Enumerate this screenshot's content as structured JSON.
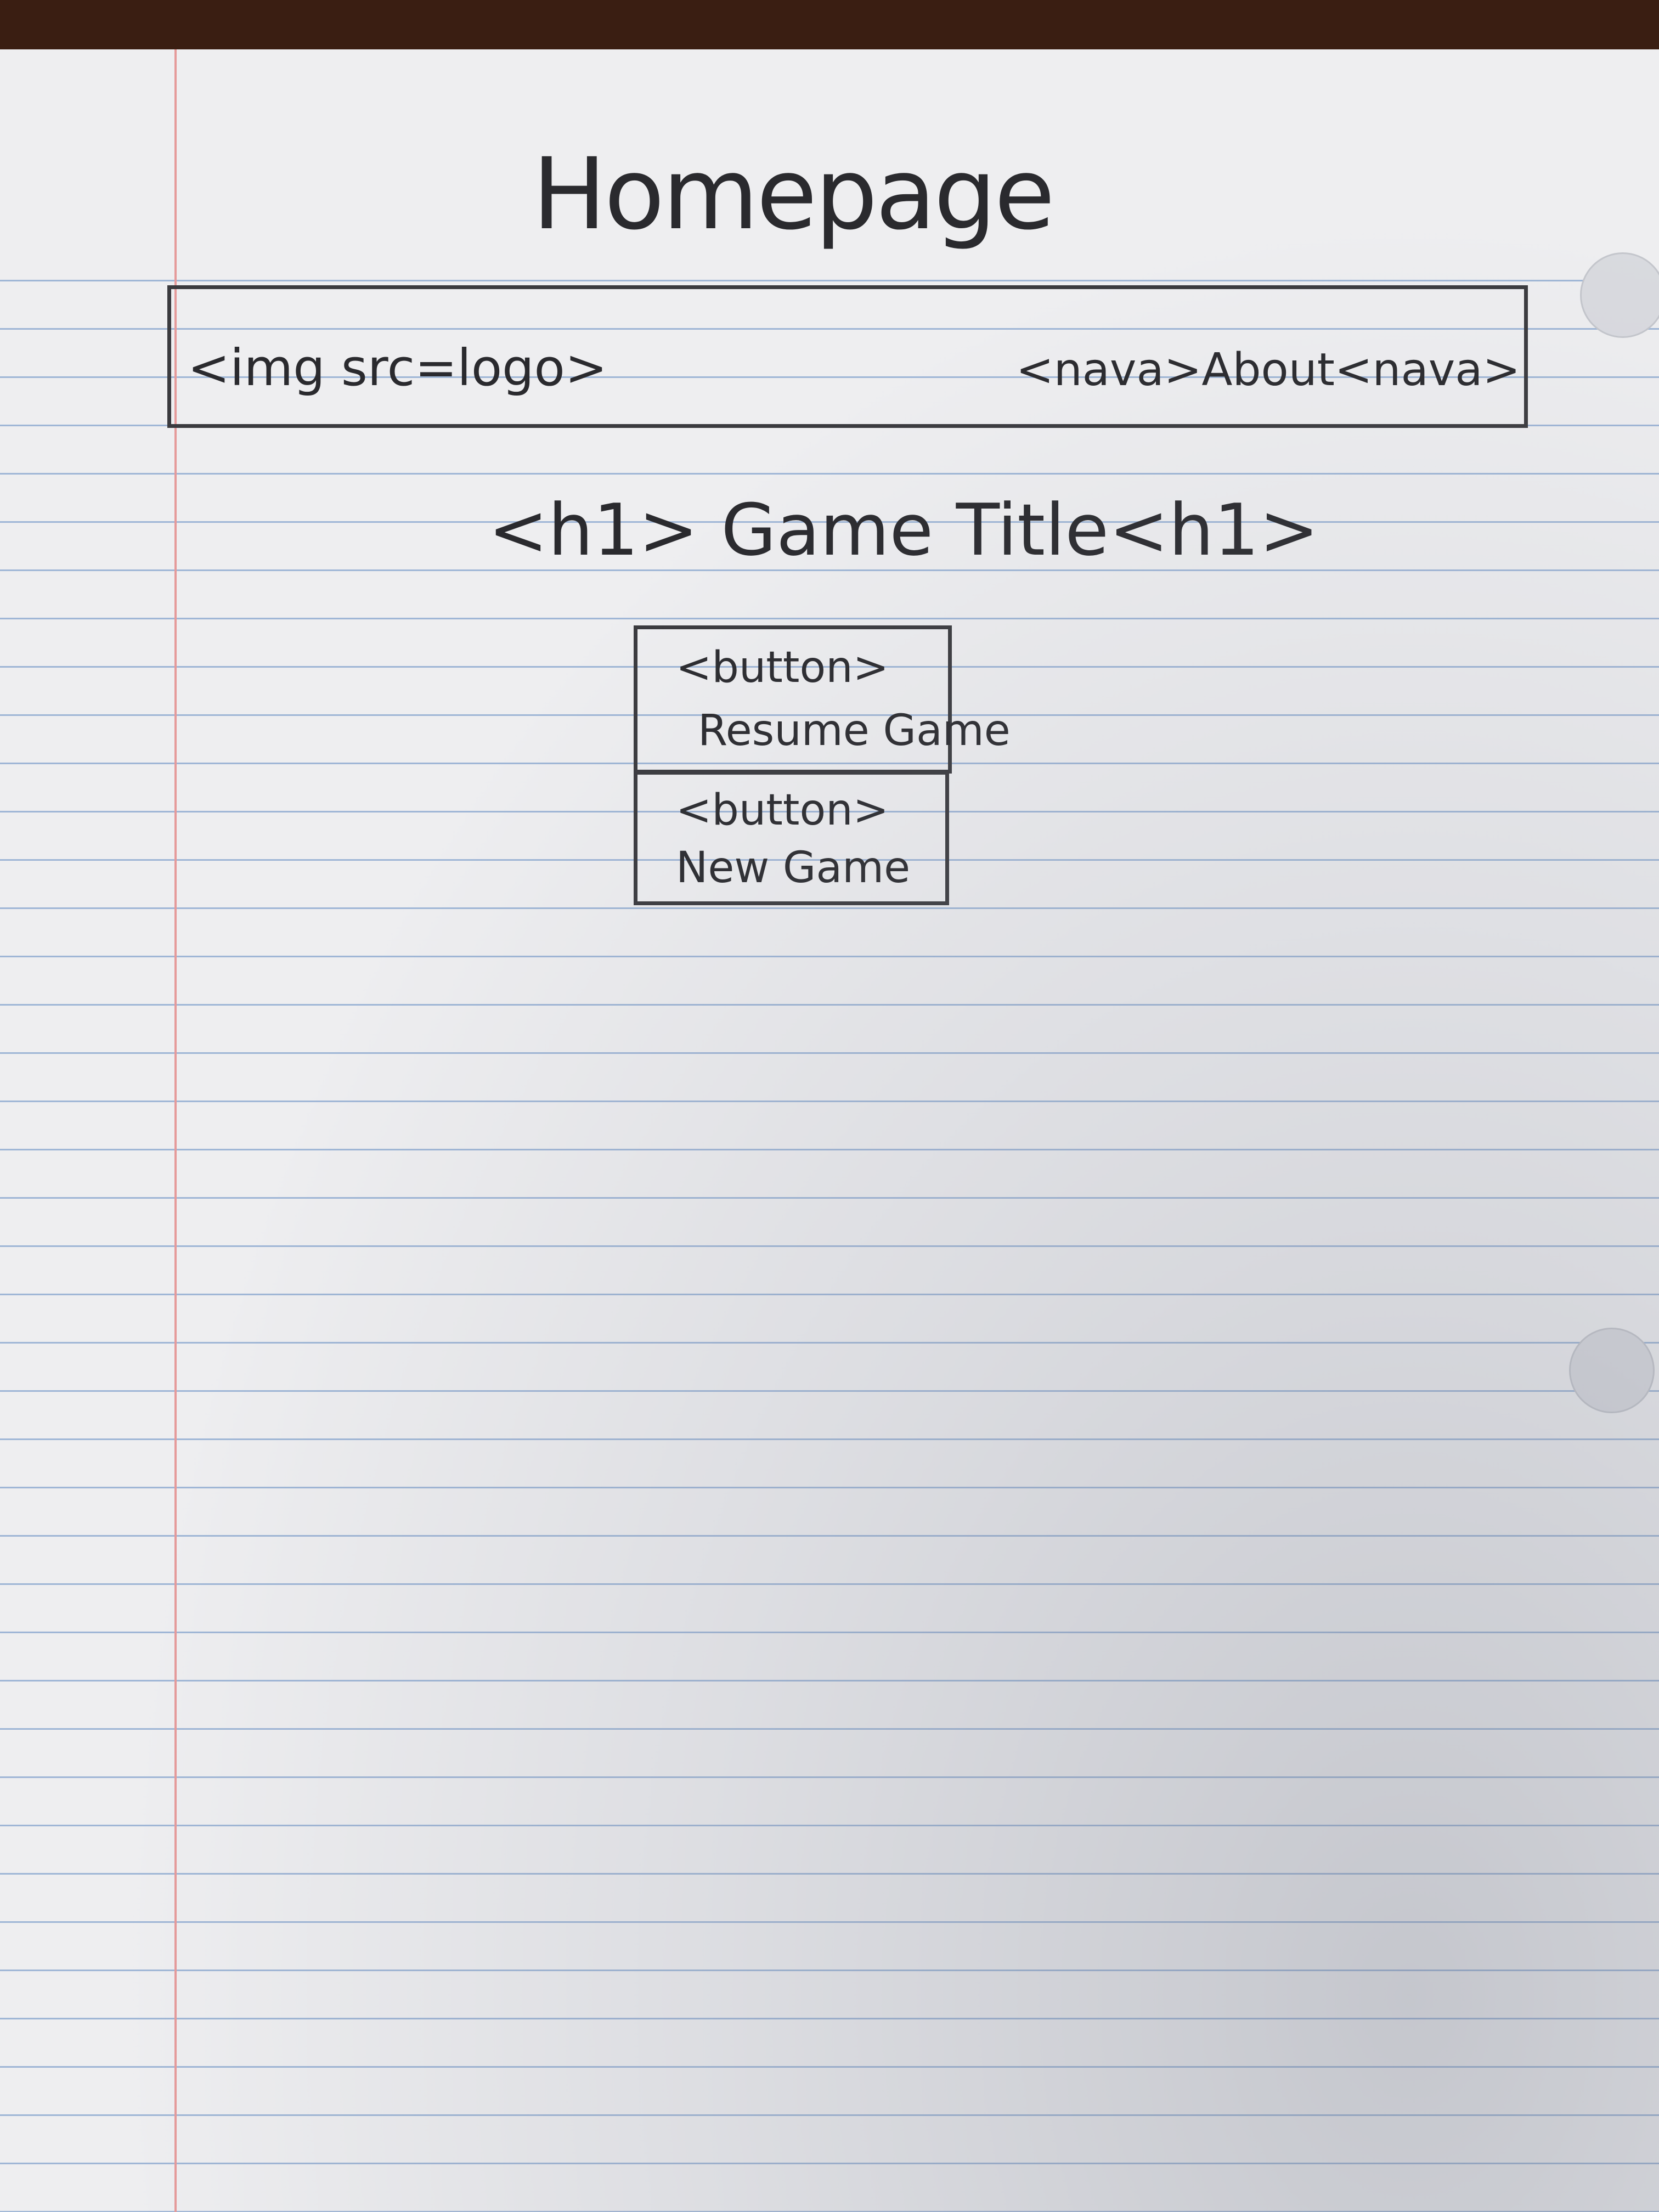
{
  "sketch": {
    "title": "Homepage",
    "header": {
      "logo_text": "<img src=logo>",
      "nav_text": "<nava>About<nava>"
    },
    "heading": "<h1> Game Title<h1>",
    "buttons": [
      {
        "tag": "<button>",
        "label": "Resume Game"
      },
      {
        "tag": "<button>",
        "label": "New Game"
      }
    ]
  }
}
